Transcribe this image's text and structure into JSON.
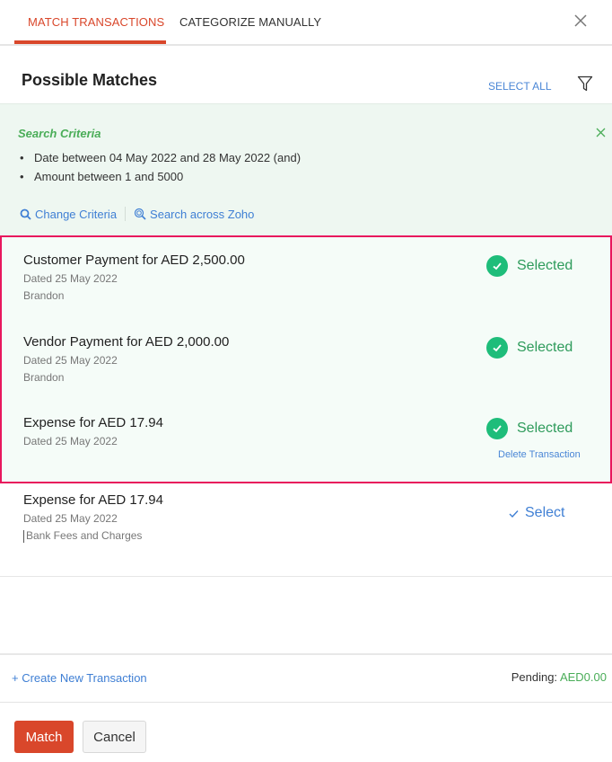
{
  "tabs": [
    {
      "label": "MATCH TRANSACTIONS",
      "active": true
    },
    {
      "label": "CATEGORIZE MANUALLY",
      "active": false
    }
  ],
  "header": {
    "title": "Possible Matches",
    "select_all": "SELECT ALL"
  },
  "criteria": {
    "title": "Search Criteria",
    "items": [
      "Date between 04 May 2022 and 28 May 2022  (and)",
      "Amount between 1 and 5000"
    ],
    "change_label": "Change Criteria",
    "search_label": "Search across Zoho"
  },
  "matches": [
    {
      "title": "Customer Payment for AED 2,500.00",
      "date": "Dated 25 May 2022",
      "party": "Brandon",
      "status": "Selected"
    },
    {
      "title": "Vendor Payment for AED 2,000.00",
      "date": "Dated 25 May 2022",
      "party": "Brandon",
      "status": "Selected"
    },
    {
      "title": "Expense for AED 17.94",
      "date": "Dated 25 May 2022",
      "status": "Selected",
      "action": "Delete Transaction"
    },
    {
      "title": "Expense for AED 17.94",
      "date": "Dated 25 May 2022",
      "account": "Bank Fees and Charges",
      "status": "Select"
    }
  ],
  "footer": {
    "create_label": "+ Create New Transaction",
    "pending_label": "Pending:",
    "pending_amount": "AED0.00",
    "match_label": "Match",
    "cancel_label": "Cancel"
  },
  "colors": {
    "accent": "#d9472b",
    "link": "#3f7fd4",
    "success": "#1ebd7a",
    "highlight_border": "#e8175d"
  }
}
